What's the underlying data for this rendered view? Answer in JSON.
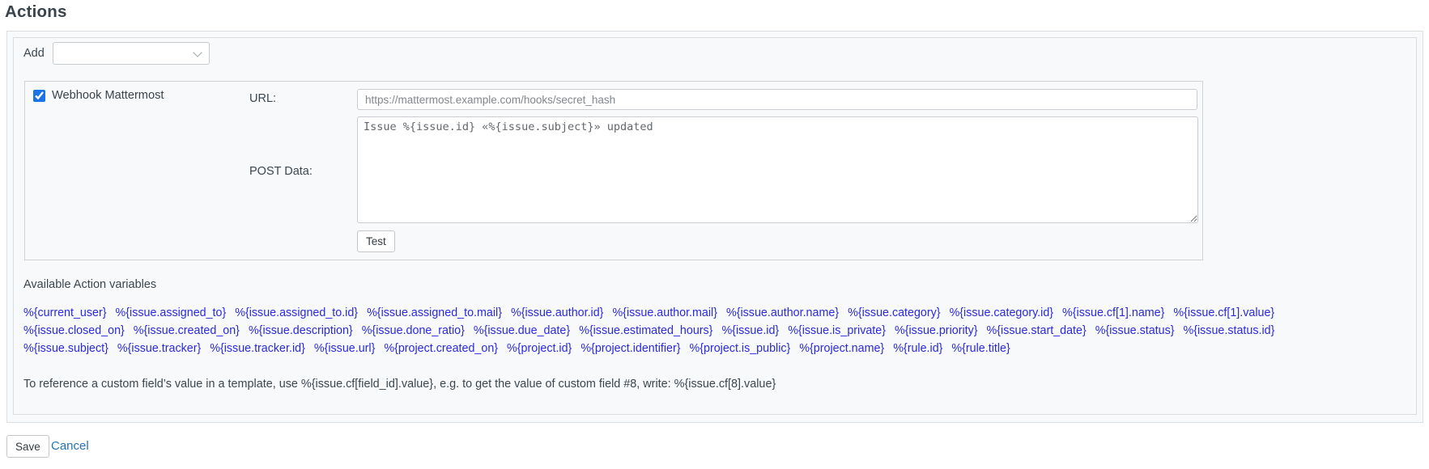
{
  "page": {
    "title": "Actions"
  },
  "add_row": {
    "label": "Add",
    "select_value": ""
  },
  "webhook": {
    "checkbox_label": "Webhook Mattermost",
    "checked": true,
    "url_label": "URL:",
    "url_value": "https://mattermost.example.com/hooks/secret_hash",
    "post_data_label": "POST Data:",
    "post_data_value": "Issue %{issue.id} «%{issue.subject}» updated",
    "test_button": "Test"
  },
  "variables_section": {
    "heading": "Available Action variables",
    "rows": [
      [
        "%{current_user}",
        "%{issue.assigned_to}",
        "%{issue.assigned_to.id}",
        "%{issue.assigned_to.mail}",
        "%{issue.author.id}",
        "%{issue.author.mail}",
        "%{issue.author.name}",
        "%{issue.category}",
        "%{issue.category.id}",
        "%{issue.cf[1].name}",
        "%{issue.cf[1].value}"
      ],
      [
        "%{issue.closed_on}",
        "%{issue.created_on}",
        "%{issue.description}",
        "%{issue.done_ratio}",
        "%{issue.due_date}",
        "%{issue.estimated_hours}",
        "%{issue.id}",
        "%{issue.is_private}",
        "%{issue.priority}",
        "%{issue.start_date}",
        "%{issue.status}",
        "%{issue.status.id}"
      ],
      [
        "%{issue.subject}",
        "%{issue.tracker}",
        "%{issue.tracker.id}",
        "%{issue.url}",
        "%{project.created_on}",
        "%{project.id}",
        "%{project.identifier}",
        "%{project.is_public}",
        "%{project.name}",
        "%{rule.id}",
        "%{rule.title}"
      ]
    ],
    "note": "To reference a custom field’s value in a template, use %{issue.cf[field_id].value}, e.g. to get the value of custom field #8, write: %{issue.cf[8].value}"
  },
  "footer": {
    "save_button": "Save",
    "cancel_link": "Cancel"
  },
  "colors": {
    "variable_blue": "#2a2ae0",
    "link_blue": "#2373b8",
    "accent_checkbox": "#1a73e8",
    "box_bg": "#f8f9fa"
  }
}
